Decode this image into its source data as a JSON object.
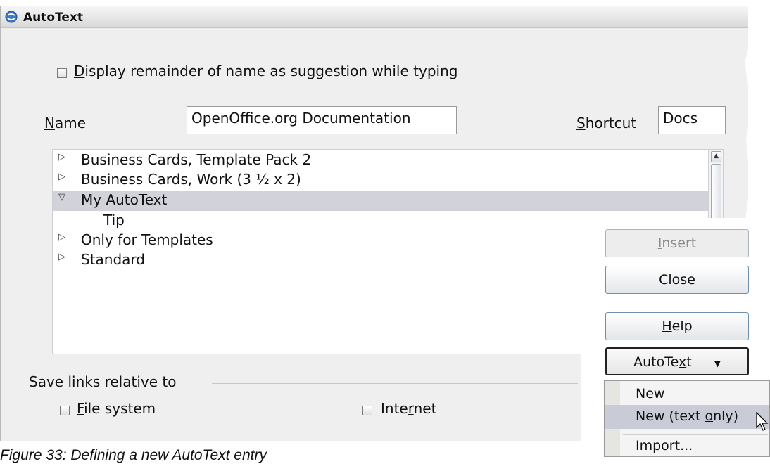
{
  "dialog": {
    "title": "AutoText",
    "display_remainder": {
      "pre": "",
      "accel": "D",
      "post": "isplay remainder of name as suggestion while typing",
      "checked": false
    },
    "name_label": {
      "accel": "N",
      "post": "ame"
    },
    "name_value": "OpenOffice.org Documentation",
    "shortcut_label": {
      "accel": "S",
      "post": "hortcut"
    },
    "shortcut_value": "Docs",
    "tree": [
      {
        "label": "Business Cards, Template Pack 2",
        "expanded": false
      },
      {
        "label": "Business Cards, Work (3 ½ x 2)",
        "expanded": false
      },
      {
        "label": "My AutoText",
        "expanded": true,
        "selected": true
      },
      {
        "label": "Tip",
        "child": true
      },
      {
        "label": "Only for Templates",
        "expanded": false
      },
      {
        "label": "Standard",
        "expanded": false
      }
    ],
    "save_links_label": "Save links relative to",
    "file_system": {
      "accel": "F",
      "post": "ile system",
      "checked": false
    },
    "internet": {
      "pre": "Inte",
      "accel": "r",
      "post": "net",
      "checked": false
    }
  },
  "buttons": {
    "insert": {
      "accel": "I",
      "post": "nsert",
      "disabled": true
    },
    "close": {
      "accel": "C",
      "post": "lose"
    },
    "help": {
      "accel": "H",
      "post": "elp"
    },
    "autotext": {
      "pre": "AutoTe",
      "accel": "x",
      "post": "t",
      "arrow": "▼"
    }
  },
  "menu": {
    "new": {
      "accel": "N",
      "post": "ew"
    },
    "new_text_only": {
      "pre": "New (text ",
      "accel": "o",
      "post": "nly)"
    },
    "import": {
      "accel": "I",
      "post": "mport..."
    }
  },
  "caption": "Figure 33: Defining a new AutoText entry",
  "colors": {
    "selection": "#d2d2da",
    "menu_highlight": "#c9ccd6",
    "button_border": "#6f8fb0"
  }
}
